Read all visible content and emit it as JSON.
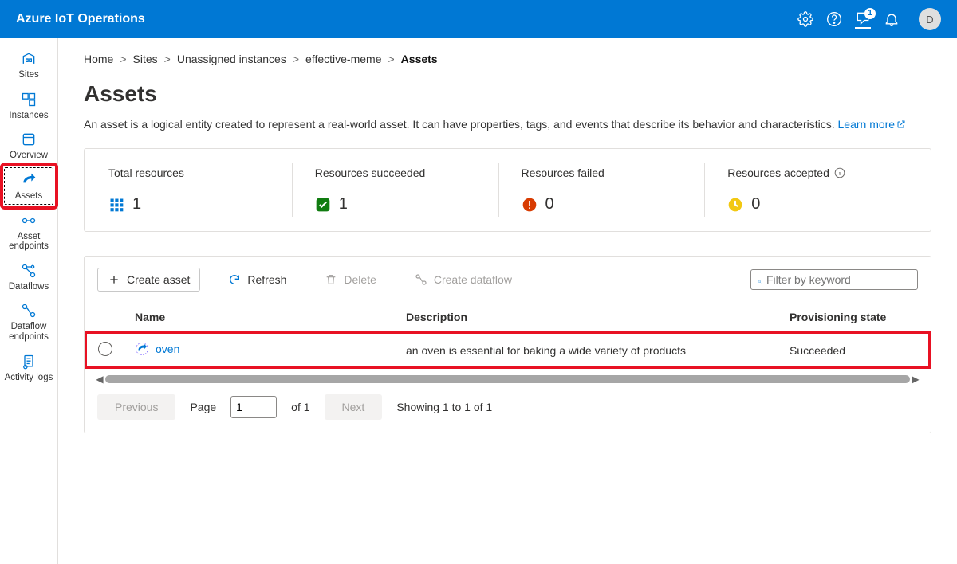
{
  "header": {
    "app_title": "Azure IoT Operations",
    "feedback_badge": "1",
    "avatar_initial": "D"
  },
  "sidenav": {
    "items": [
      {
        "id": "sites",
        "label": "Sites"
      },
      {
        "id": "instances",
        "label": "Instances"
      },
      {
        "id": "overview",
        "label": "Overview"
      },
      {
        "id": "assets",
        "label": "Assets"
      },
      {
        "id": "asset-endpoints",
        "label": "Asset endpoints"
      },
      {
        "id": "dataflows",
        "label": "Dataflows"
      },
      {
        "id": "dataflow-endpoints",
        "label": "Dataflow endpoints"
      },
      {
        "id": "activity-logs",
        "label": "Activity logs"
      }
    ]
  },
  "breadcrumb": {
    "items": [
      "Home",
      "Sites",
      "Unassigned instances",
      "effective-meme",
      "Assets"
    ]
  },
  "page": {
    "title": "Assets",
    "description": "An asset is a logical entity created to represent a real-world asset. It can have properties, tags, and events that describe its behavior and characteristics. ",
    "learn_more": "Learn more"
  },
  "stats": [
    {
      "id": "total",
      "label": "Total resources",
      "value": "1"
    },
    {
      "id": "succeeded",
      "label": "Resources succeeded",
      "value": "1"
    },
    {
      "id": "failed",
      "label": "Resources failed",
      "value": "0"
    },
    {
      "id": "accepted",
      "label": "Resources accepted",
      "value": "0"
    }
  ],
  "toolbar": {
    "create": "Create asset",
    "refresh": "Refresh",
    "delete": "Delete",
    "create_dataflow": "Create dataflow",
    "filter_placeholder": "Filter by keyword"
  },
  "table": {
    "columns": [
      "Name",
      "Description",
      "Provisioning state"
    ],
    "rows": [
      {
        "name": "oven",
        "description": "an oven is essential for baking a wide variety of products",
        "state": "Succeeded"
      }
    ]
  },
  "pager": {
    "prev": "Previous",
    "next": "Next",
    "page_label": "Page",
    "page_value": "1",
    "of": "of 1",
    "showing": "Showing 1 to 1 of 1"
  }
}
